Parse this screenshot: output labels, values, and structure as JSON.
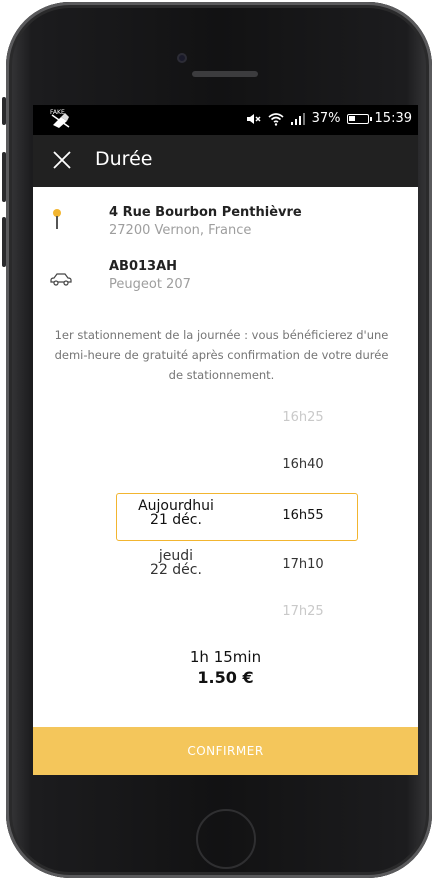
{
  "statusbar": {
    "battery": "37%",
    "battery_level": 0.37,
    "time": "15:39"
  },
  "header": {
    "title": "Durée"
  },
  "location": {
    "address_line1": "4 Rue Bourbon Penthièvre",
    "address_line2": "27200 Vernon, France"
  },
  "vehicle": {
    "plate": "AB013AH",
    "model": "Peugeot 207"
  },
  "info_text": "1er stationnement de la journée : vous bénéficierez d'une demi-heure de gratuité après confirmation de votre durée de stationnement.",
  "picker": {
    "days": [
      {
        "line1": "Aujourdhui",
        "line2": "21 déc."
      },
      {
        "line1": "jeudi",
        "line2": "22 déc."
      }
    ],
    "times": [
      "16h25",
      "16h40",
      "16h55",
      "17h10",
      "17h25"
    ]
  },
  "summary": {
    "duration": "1h 15min",
    "price": "1.50 €"
  },
  "confirm_label": "CONFIRMER",
  "colors": {
    "accent": "#f2b530",
    "confirm_bg": "#f4c65b",
    "topbar_bg": "#212121"
  }
}
